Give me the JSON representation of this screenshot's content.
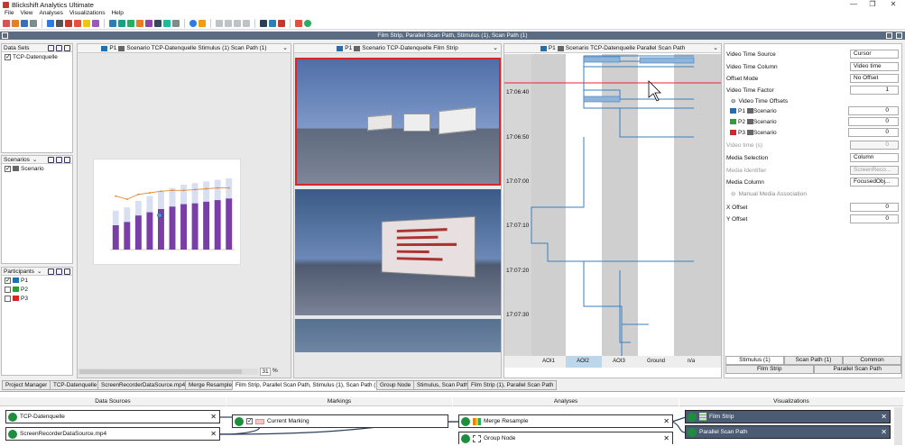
{
  "window": {
    "title": "Blickshift Analytics Ultimate",
    "min": "—",
    "max": "❐",
    "close": "✕"
  },
  "menu": [
    "File",
    "View",
    "Analyses",
    "Visualizations",
    "Help"
  ],
  "strip_title": "Film Strip, Parallel Scan Path, Stimulus (1), Scan Path (1)",
  "datasets": {
    "title": "Data Sets",
    "items": [
      {
        "label": "TCP-Datenquelle",
        "checked": true
      }
    ]
  },
  "scenarios": {
    "title": "Scenarios",
    "items": [
      {
        "label": "Scenario",
        "checked": true
      }
    ]
  },
  "participants": {
    "title": "Participants",
    "items": [
      {
        "label": "P1",
        "checked": true,
        "color": "#1f6fb5"
      },
      {
        "label": "P2",
        "checked": false,
        "color": "#2e9e3a"
      },
      {
        "label": "P3",
        "checked": false,
        "color": "#d62728"
      }
    ]
  },
  "scanpath_view": {
    "p": "P1",
    "title": "Scenario TCP-Datenquelle Stimulus (1) Scan Path (1)",
    "zoom": "31",
    "zoom_unit": "%"
  },
  "film_view": {
    "p": "P1",
    "title": "Scenario TCP-Datenquelle Film Strip"
  },
  "parallel_view": {
    "p": "P1",
    "title": "Scenario TCP-Datenquelle Parallel Scan Path",
    "times": [
      "17:06:40",
      "17:06:50",
      "17:07:00",
      "17:07:10",
      "17:07:20",
      "17:07:30"
    ],
    "aois": [
      "AOI1",
      "AOI2",
      "AOI3",
      "Ground",
      "n/a"
    ]
  },
  "props": {
    "video_time_source": {
      "label": "Video Time Source",
      "value": "Cursor"
    },
    "video_time_column": {
      "label": "Video Time Column",
      "value": "Video time"
    },
    "offset_mode": {
      "label": "Offset Mode",
      "value": "No Offset"
    },
    "video_time_factor": {
      "label": "Video Time Factor",
      "value": "1"
    },
    "video_time_offsets": "Video Time Offsets",
    "offsets": [
      {
        "p": "P1",
        "s": "Scenario",
        "value": "0",
        "color": "#1f6fb5"
      },
      {
        "p": "P2",
        "s": "Scenario",
        "value": "0",
        "color": "#2e9e3a"
      },
      {
        "p": "P3",
        "s": "Scenario",
        "value": "0",
        "color": "#d62728"
      }
    ],
    "video_time": {
      "label": "Video time (s)",
      "value": "0"
    },
    "media_selection": {
      "label": "Media Selection",
      "value": "Column"
    },
    "media_identifier": {
      "label": "Media Identifier",
      "value": "ScreenReco..."
    },
    "media_column": {
      "label": "Media Column",
      "value": "FocusedObj..."
    },
    "manual_media": "Manual Media Association",
    "x_offset": {
      "label": "X Offset",
      "value": "0"
    },
    "y_offset": {
      "label": "Y Offset",
      "value": "0"
    },
    "tabs_row1": [
      "Stimulus (1)",
      "Scan Path (1)",
      "Common"
    ],
    "tabs_row2": [
      "Film Strip",
      "Parallel Scan Path"
    ]
  },
  "bottom_tabs": [
    "Project Manager",
    "TCP-Datenquelle",
    "ScreenRecorderDataSource.mp4",
    "Merge Resample",
    "Film Strip, Parallel Scan Path, Stimulus (1), Scan Path (1)",
    "Group Node",
    "Stimulus, Scan Path",
    "Film Strip (1), Parallel Scan Path"
  ],
  "pipeline": {
    "columns": [
      "Data Sources",
      "Markings",
      "Analyses",
      "Visualizations"
    ],
    "sources": [
      "TCP-Datenquelle",
      "ScreenRecorderDataSource.mp4"
    ],
    "markings": [
      "Current Marking"
    ],
    "analyses": [
      "Merge Resample",
      "Group Node"
    ],
    "visualizations": [
      "Film Strip",
      "Parallel Scan Path"
    ]
  },
  "chart_data": {
    "type": "bar",
    "categories": [
      "",
      "",
      "",
      "",
      "",
      "",
      "",
      "",
      "",
      "",
      ""
    ],
    "series": [
      {
        "values": [
          30,
          34,
          42,
          46,
          50,
          53,
          56,
          57,
          59,
          61,
          63
        ]
      },
      {
        "values": [
          48,
          52,
          60,
          66,
          72,
          76,
          80,
          82,
          84,
          86,
          88
        ]
      },
      {
        "values": [
          66,
          62,
          68,
          70,
          72,
          73,
          73,
          74,
          75,
          76,
          76
        ]
      }
    ]
  }
}
